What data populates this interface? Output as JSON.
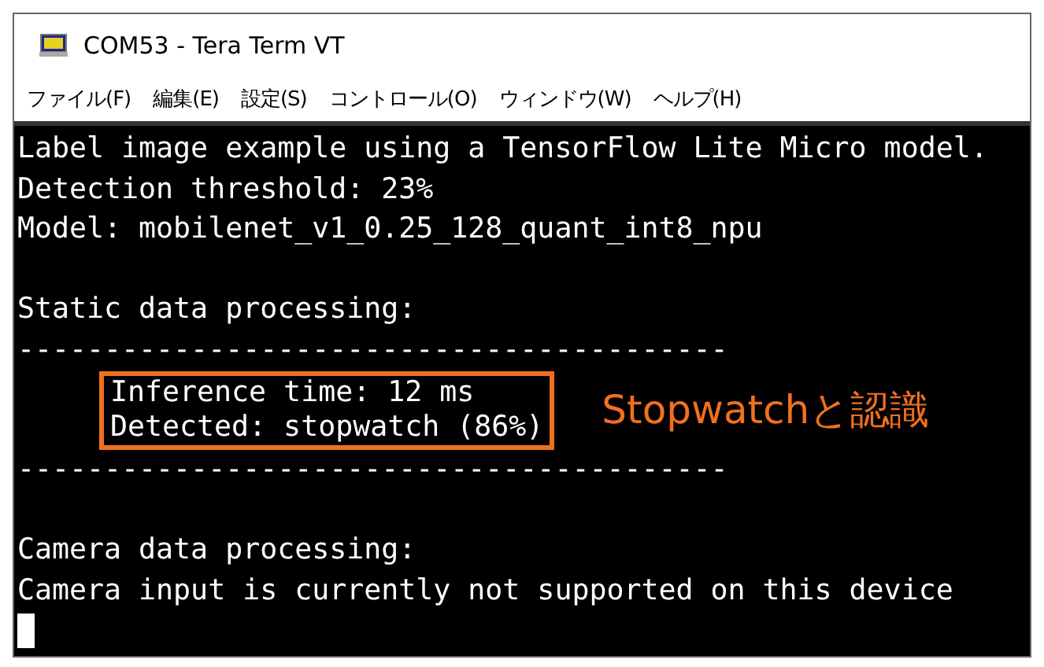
{
  "window": {
    "title": "COM53 - Tera Term VT"
  },
  "menu": [
    "ファイル(F)",
    "編集(E)",
    "設定(S)",
    "コントロール(O)",
    "ウィンドウ(W)",
    "ヘルプ(H)"
  ],
  "terminal": {
    "lines": [
      {
        "kind": "text",
        "text": "Label image example using a TensorFlow Lite Micro model."
      },
      {
        "kind": "text",
        "text": "Detection threshold: 23%"
      },
      {
        "kind": "text",
        "text": "Model: mobilenet_v1_0.25_128_quant_int8_npu"
      },
      {
        "kind": "blank"
      },
      {
        "kind": "text",
        "text": "Static data processing:"
      },
      {
        "kind": "text",
        "text": "-----------------------------------------"
      },
      {
        "kind": "highlight",
        "lines": [
          "Inference time: 12 ms",
          "Detected: stopwatch (86%)"
        ],
        "note": "Stopwatchと認識"
      },
      {
        "kind": "text",
        "text": "-----------------------------------------"
      },
      {
        "kind": "blank"
      },
      {
        "kind": "text",
        "text": "Camera data processing:"
      },
      {
        "kind": "text",
        "text": "Camera input is currently not supported on this device"
      },
      {
        "kind": "cursor"
      }
    ]
  }
}
